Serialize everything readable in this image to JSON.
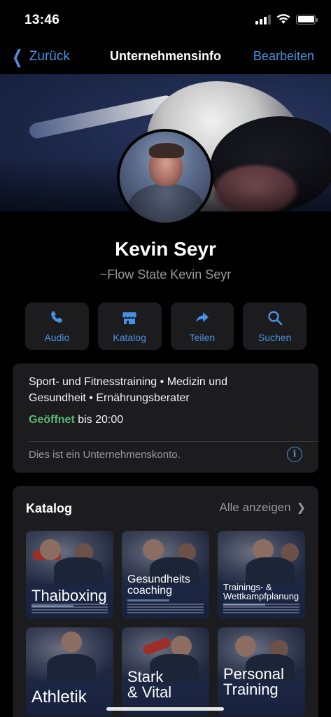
{
  "status_bar": {
    "time": "13:46"
  },
  "nav": {
    "back_label": "Zurück",
    "title": "Unternehmensinfo",
    "edit_label": "Bearbeiten"
  },
  "profile": {
    "name": "Kevin Seyr",
    "subtitle": "~Flow State Kevin Seyr"
  },
  "actions": [
    {
      "label": "Audio",
      "icon": "phone-icon"
    },
    {
      "label": "Katalog",
      "icon": "storefront-icon"
    },
    {
      "label": "Teilen",
      "icon": "share-arrow-icon"
    },
    {
      "label": "Suchen",
      "icon": "search-icon"
    }
  ],
  "info": {
    "categories": "Sport- und Fitnesstraining • Medizin und Gesundheit • Ernährungsberater",
    "open_status": "Geöffnet",
    "hours": " bis 20:00",
    "note": "Dies ist ein Unternehmenskonto.",
    "info_icon_text": "i"
  },
  "catalog": {
    "title": "Katalog",
    "see_all": "Alle anzeigen",
    "items": [
      {
        "label": "Thaiboxing"
      },
      {
        "label": "Gesundheits coaching"
      },
      {
        "label": "Trainings- & Wettkampfplanung"
      },
      {
        "label": "Athletik"
      },
      {
        "label": "Stark & Vital"
      },
      {
        "label": "Personal Training"
      }
    ]
  },
  "colors": {
    "accent": "#4a90e2",
    "open_green": "#5bb974",
    "card_bg": "#1c1c1e"
  }
}
